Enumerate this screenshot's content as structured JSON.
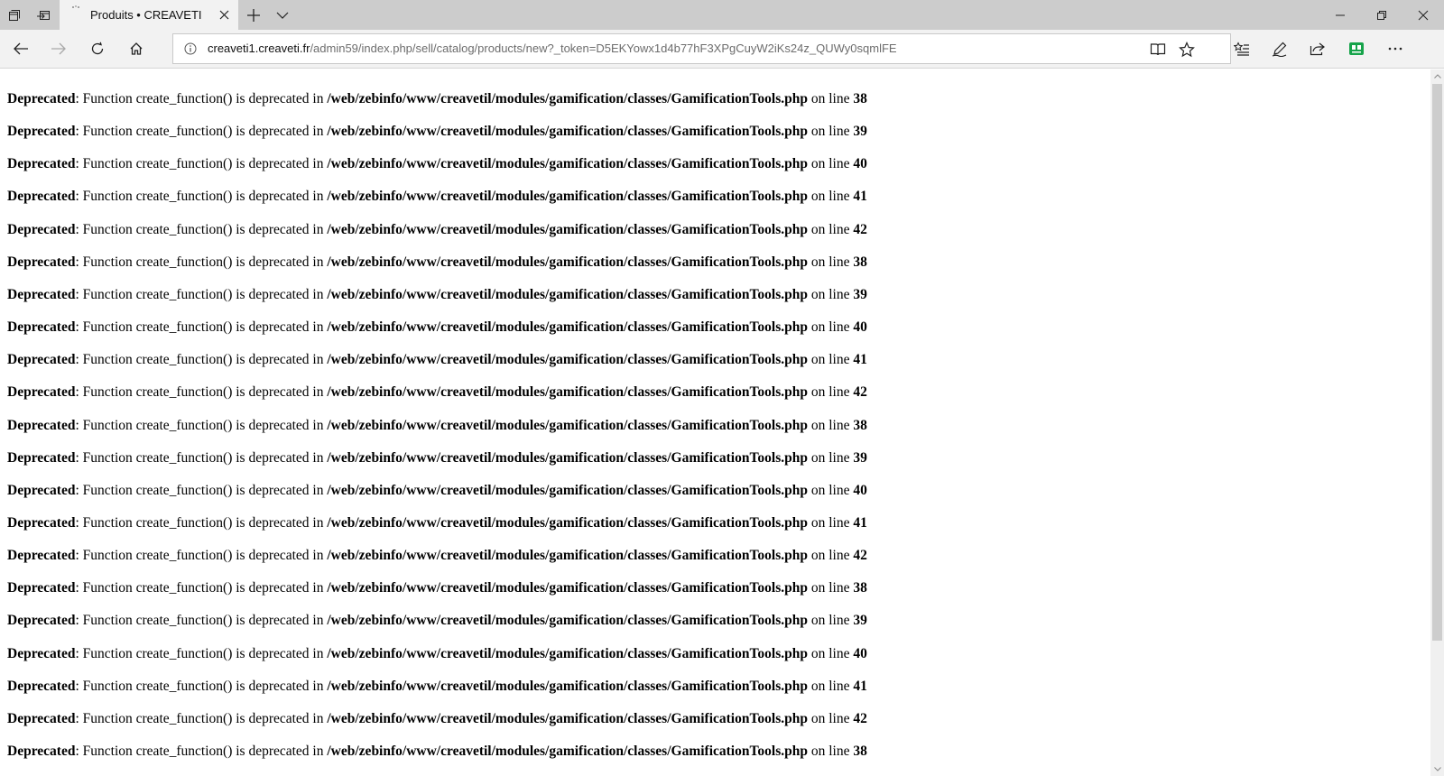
{
  "tab": {
    "title": "Produits • CREAVETI"
  },
  "address": {
    "host": "creaveti1.creaveti.fr",
    "path": "/admin59/index.php/sell/catalog/products/new?_token=D5EKYowx1d4b77hF3XPgCuyW2iKs24z_QUWy0sqmlFE"
  },
  "colors": {
    "accent_green": "#16a34a"
  },
  "messages": [
    {
      "level": "Deprecated",
      "text": ": Function create_function() is deprecated in ",
      "file": "/web/zebinfo/www/creavetil/modules/gamification/classes/GamificationTools.php",
      "on": " on line ",
      "line": "38"
    },
    {
      "level": "Deprecated",
      "text": ": Function create_function() is deprecated in ",
      "file": "/web/zebinfo/www/creavetil/modules/gamification/classes/GamificationTools.php",
      "on": " on line ",
      "line": "39"
    },
    {
      "level": "Deprecated",
      "text": ": Function create_function() is deprecated in ",
      "file": "/web/zebinfo/www/creavetil/modules/gamification/classes/GamificationTools.php",
      "on": " on line ",
      "line": "40"
    },
    {
      "level": "Deprecated",
      "text": ": Function create_function() is deprecated in ",
      "file": "/web/zebinfo/www/creavetil/modules/gamification/classes/GamificationTools.php",
      "on": " on line ",
      "line": "41"
    },
    {
      "level": "Deprecated",
      "text": ": Function create_function() is deprecated in ",
      "file": "/web/zebinfo/www/creavetil/modules/gamification/classes/GamificationTools.php",
      "on": " on line ",
      "line": "42"
    },
    {
      "level": "Deprecated",
      "text": ": Function create_function() is deprecated in ",
      "file": "/web/zebinfo/www/creavetil/modules/gamification/classes/GamificationTools.php",
      "on": " on line ",
      "line": "38"
    },
    {
      "level": "Deprecated",
      "text": ": Function create_function() is deprecated in ",
      "file": "/web/zebinfo/www/creavetil/modules/gamification/classes/GamificationTools.php",
      "on": " on line ",
      "line": "39"
    },
    {
      "level": "Deprecated",
      "text": ": Function create_function() is deprecated in ",
      "file": "/web/zebinfo/www/creavetil/modules/gamification/classes/GamificationTools.php",
      "on": " on line ",
      "line": "40"
    },
    {
      "level": "Deprecated",
      "text": ": Function create_function() is deprecated in ",
      "file": "/web/zebinfo/www/creavetil/modules/gamification/classes/GamificationTools.php",
      "on": " on line ",
      "line": "41"
    },
    {
      "level": "Deprecated",
      "text": ": Function create_function() is deprecated in ",
      "file": "/web/zebinfo/www/creavetil/modules/gamification/classes/GamificationTools.php",
      "on": " on line ",
      "line": "42"
    },
    {
      "level": "Deprecated",
      "text": ": Function create_function() is deprecated in ",
      "file": "/web/zebinfo/www/creavetil/modules/gamification/classes/GamificationTools.php",
      "on": " on line ",
      "line": "38"
    },
    {
      "level": "Deprecated",
      "text": ": Function create_function() is deprecated in ",
      "file": "/web/zebinfo/www/creavetil/modules/gamification/classes/GamificationTools.php",
      "on": " on line ",
      "line": "39"
    },
    {
      "level": "Deprecated",
      "text": ": Function create_function() is deprecated in ",
      "file": "/web/zebinfo/www/creavetil/modules/gamification/classes/GamificationTools.php",
      "on": " on line ",
      "line": "40"
    },
    {
      "level": "Deprecated",
      "text": ": Function create_function() is deprecated in ",
      "file": "/web/zebinfo/www/creavetil/modules/gamification/classes/GamificationTools.php",
      "on": " on line ",
      "line": "41"
    },
    {
      "level": "Deprecated",
      "text": ": Function create_function() is deprecated in ",
      "file": "/web/zebinfo/www/creavetil/modules/gamification/classes/GamificationTools.php",
      "on": " on line ",
      "line": "42"
    },
    {
      "level": "Deprecated",
      "text": ": Function create_function() is deprecated in ",
      "file": "/web/zebinfo/www/creavetil/modules/gamification/classes/GamificationTools.php",
      "on": " on line ",
      "line": "38"
    },
    {
      "level": "Deprecated",
      "text": ": Function create_function() is deprecated in ",
      "file": "/web/zebinfo/www/creavetil/modules/gamification/classes/GamificationTools.php",
      "on": " on line ",
      "line": "39"
    },
    {
      "level": "Deprecated",
      "text": ": Function create_function() is deprecated in ",
      "file": "/web/zebinfo/www/creavetil/modules/gamification/classes/GamificationTools.php",
      "on": " on line ",
      "line": "40"
    },
    {
      "level": "Deprecated",
      "text": ": Function create_function() is deprecated in ",
      "file": "/web/zebinfo/www/creavetil/modules/gamification/classes/GamificationTools.php",
      "on": " on line ",
      "line": "41"
    },
    {
      "level": "Deprecated",
      "text": ": Function create_function() is deprecated in ",
      "file": "/web/zebinfo/www/creavetil/modules/gamification/classes/GamificationTools.php",
      "on": " on line ",
      "line": "42"
    },
    {
      "level": "Deprecated",
      "text": ": Function create_function() is deprecated in ",
      "file": "/web/zebinfo/www/creavetil/modules/gamification/classes/GamificationTools.php",
      "on": " on line ",
      "line": "38"
    }
  ]
}
